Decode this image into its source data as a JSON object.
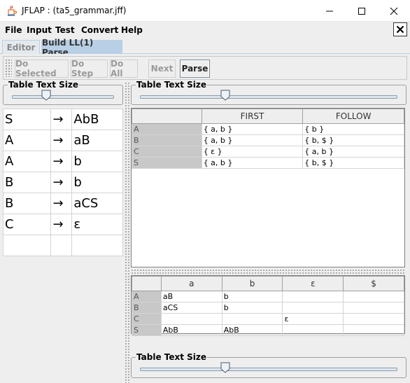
{
  "window": {
    "title": "JFLAP : (ta5_grammar.jff)"
  },
  "menu": [
    "File",
    "Input",
    "Test",
    "Convert",
    "Help"
  ],
  "tabs": [
    "Editor",
    "Build LL(1) Parse"
  ],
  "toolbar": {
    "do_selected": "Do Selected",
    "do_step": "Do Step",
    "do_all": "Do All",
    "next": "Next",
    "parse": "Parse"
  },
  "slider_label": "Table Text Size",
  "grammar": [
    {
      "lhs": "S",
      "arrow": "→",
      "rhs": "AbB"
    },
    {
      "lhs": "A",
      "arrow": "→",
      "rhs": "aB"
    },
    {
      "lhs": "A",
      "arrow": "→",
      "rhs": "b"
    },
    {
      "lhs": "B",
      "arrow": "→",
      "rhs": "b"
    },
    {
      "lhs": "B",
      "arrow": "→",
      "rhs": "aCS"
    },
    {
      "lhs": "C",
      "arrow": "→",
      "rhs": "ε"
    },
    {
      "lhs": "",
      "arrow": "",
      "rhs": ""
    }
  ],
  "first_follow": {
    "headers": [
      "",
      "FIRST",
      "FOLLOW"
    ],
    "rows": [
      [
        "A",
        "{ a, b }",
        "{ b }"
      ],
      [
        "B",
        "{ a, b }",
        "{ b, $ }"
      ],
      [
        "C",
        "{ ε }",
        "{ a, b }"
      ],
      [
        "S",
        "{ a, b }",
        "{ b, $ }"
      ]
    ]
  },
  "parse_table": {
    "headers": [
      "",
      "a",
      "b",
      "ε",
      "$"
    ],
    "rows": [
      [
        "A",
        "aB",
        "b",
        "",
        ""
      ],
      [
        "B",
        "aCS",
        "b",
        "",
        ""
      ],
      [
        "C",
        "",
        "",
        "ε",
        ""
      ],
      [
        "S",
        "AbB",
        "AbB",
        "",
        ""
      ]
    ]
  },
  "colors": {
    "tab_active": "#b8cfe5",
    "row_header": "#c8c8c8",
    "panel": "#eeeeee"
  }
}
